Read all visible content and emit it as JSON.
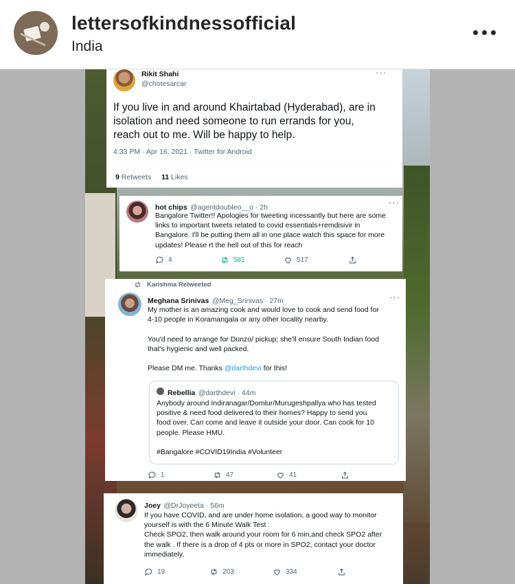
{
  "header": {
    "account_name": "lettersofkindnessofficial",
    "location": "India"
  },
  "tweets": [
    {
      "name": "Rikit Shahi",
      "handle": "@chotesarcar",
      "text": "If you live in and around Khairtabad (Hyderabad), are in\nisolation and need someone to run errands for you,\nreach out to me. Will be happy to help.",
      "meta": "4:33 PM · Apr 16, 2021 · Twitter for Android",
      "retweets_count": "9",
      "retweets_label": "Retweets",
      "likes_count": "11",
      "likes_label": "Likes"
    },
    {
      "name": "hot chips",
      "handle": "@agentdoubleo__o · 2h",
      "text": "Bangalore Twitter!! Apologies for tweeting incessantly but here are some\nlinks to important tweets related to covid essentials+remdisivir in\nBangalore. I'll be putting them all in one place watch this space for more\nupdates! Please rt the hell out of this for reach",
      "replies": "4",
      "retweets": "581",
      "likes": "517"
    },
    {
      "retweeted_by": "Karishma Retweeted",
      "name": "Meghana Srinivas",
      "handle": "@Meg_Srinivas · 27m",
      "text": "My mother is an amazing cook and would love to cook and send food for\n4-10 people in Koramangala or any other locality nearby.\n\nYou'd need to arrange for Dunzo/ pickup; she'll ensure South Indian food\nthat's hygienic and well packed.\n\nPlease DM me. Thanks ",
      "mention": "@darthdevi",
      "text_end": " for this!",
      "quote": {
        "name": "Rebellia",
        "handle": "@darthdevi · 44m",
        "text": "Anybody around Indiranagar/Domlur/Murugeshpallya who has tested\npositive & need food delivered to their homes? Happy to send you\nfood over. Can come and leave it outside your door. Can cook for 10\npeople. Please HMU.\n\n#Bangalore #COVID19India #Volunteer"
      },
      "replies": "1",
      "retweets": "47",
      "likes": "41"
    },
    {
      "name": "Joey",
      "handle": "@DrJoyeeta · 56m",
      "text": "If you have COVID, and are under home isolation, a good way to monitor\nyourself is with the 6 Minute Walk Test .\nCheck SPO2, then walk around your room for 6 min,and check SPO2 after\nthe walk . If there is a drop of 4 pts or more in SPO2, contact your doctor\nimmediately.",
      "replies": "19",
      "retweets": "203",
      "likes": "334"
    }
  ],
  "colors": {
    "link_blue": "#1d9bf0",
    "retweet_green": "#00ba7c",
    "muted_text": "#536471"
  },
  "icons": [
    "more-options-icon",
    "reply-icon",
    "retweet-icon",
    "like-icon",
    "share-icon"
  ]
}
